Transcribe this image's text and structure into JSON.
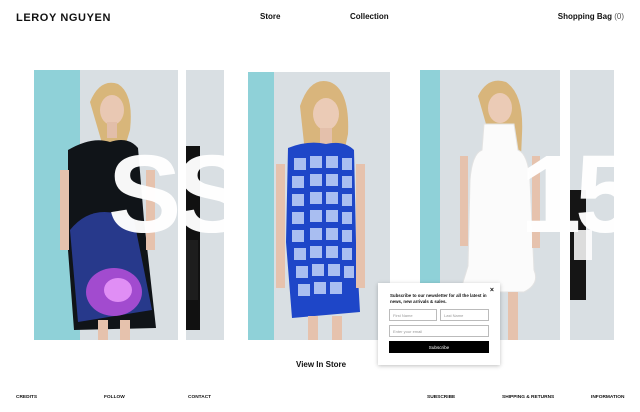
{
  "header": {
    "brand": "LEROY NGUYEN",
    "nav": {
      "store": "Store",
      "collection": "Collection"
    },
    "bag": {
      "label": "Shopping Bag",
      "count": "(0)"
    }
  },
  "hero": {
    "season_letters": "SS",
    "season_year": "15",
    "cta": "View In Store",
    "colors": {
      "aqua": "#8fd1d8",
      "backdrop": "#d9dfe3"
    }
  },
  "newsletter": {
    "message": "Subscribe to our newsletter for all the latest in news, new arrivals & sales.",
    "first_name_placeholder": "First Name",
    "last_name_placeholder": "Last Name",
    "email_placeholder": "Enter your email",
    "submit": "Subscribe",
    "close": "×"
  },
  "footer": {
    "credits": "CREDITS",
    "follow": "FOLLOW",
    "contact": "CONTACT",
    "subscribe": "SUBSCRIBE",
    "shipping": "SHIPPING & RETURNS",
    "information": "INFORMATION"
  }
}
